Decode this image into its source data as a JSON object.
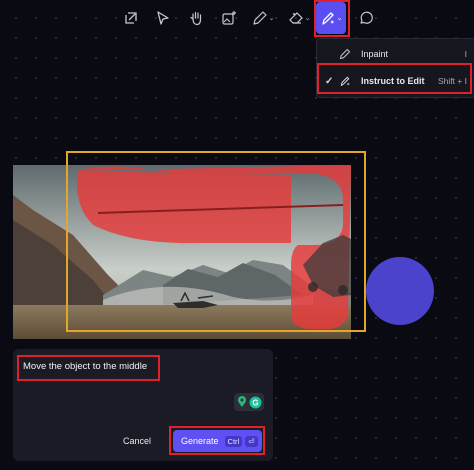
{
  "toolbar": {
    "tools": [
      {
        "icon": "select-frame-icon"
      },
      {
        "icon": "pointer-icon"
      },
      {
        "icon": "hand-icon"
      },
      {
        "icon": "image-add-icon"
      },
      {
        "icon": "pen-icon"
      },
      {
        "icon": "eraser-icon"
      },
      {
        "icon": "magic-pen-icon"
      },
      {
        "icon": "comment-icon"
      }
    ],
    "active_tool": "magic-pen-icon",
    "dropdown_caret": "⌄"
  },
  "menu": {
    "items": [
      {
        "label": "Inpaint",
        "icon": "brush-icon",
        "shortcut": "I",
        "checked": false
      },
      {
        "label": "Instruct to Edit",
        "icon": "magic-pen-icon",
        "shortcut": "Shift + I",
        "checked": true
      }
    ],
    "check_mark": "✓"
  },
  "canvas": {
    "selection_color": "#e4a62a",
    "mask_color": "#e83a3a",
    "circle_color": "#4f47d6"
  },
  "prompt": {
    "text": "Move the object to the middle",
    "cancel_label": "Cancel",
    "generate_label": "Generate",
    "shortcut_key": "Ctrl",
    "enter_glyph": "⏎"
  },
  "colors": {
    "accent": "#5e50f2",
    "highlight": "#e0202a",
    "background": "#0a0a12"
  }
}
